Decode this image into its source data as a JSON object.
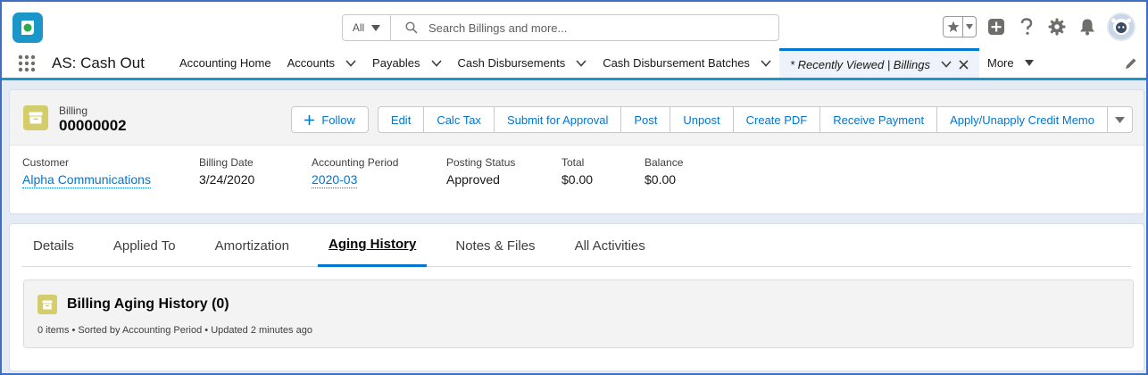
{
  "header": {
    "search_scope": "All",
    "search_placeholder": "Search Billings and more...",
    "brand_color": "#1b96c8"
  },
  "nav": {
    "app_name": "AS: Cash Out",
    "items": [
      {
        "label": "Accounting Home",
        "has_caret": false
      },
      {
        "label": "Accounts",
        "has_caret": true
      },
      {
        "label": "Payables",
        "has_caret": true
      },
      {
        "label": "Cash Disbursements",
        "has_caret": true
      },
      {
        "label": "Cash Disbursement Batches",
        "has_caret": true
      }
    ],
    "active_tab": "* Recently Viewed | Billings",
    "more_label": "More"
  },
  "record": {
    "object_label": "Billing",
    "name": "00000002",
    "icon_color": "#d3cd6b",
    "follow_label": "Follow",
    "actions": [
      "Edit",
      "Calc Tax",
      "Submit for Approval",
      "Post",
      "Unpost",
      "Create PDF",
      "Receive Payment",
      "Apply/Unapply Credit Memo"
    ],
    "fields": [
      {
        "label": "Customer",
        "value": "Alpha Communications",
        "link": true
      },
      {
        "label": "Billing Date",
        "value": "3/24/2020",
        "link": false
      },
      {
        "label": "Accounting Period",
        "value": "2020-03",
        "link": true
      },
      {
        "label": "Posting Status",
        "value": "Approved",
        "link": false
      },
      {
        "label": "Total",
        "value": "$0.00",
        "link": false
      },
      {
        "label": "Balance",
        "value": "$0.00",
        "link": false
      }
    ]
  },
  "tabs": {
    "items": [
      "Details",
      "Applied To",
      "Amortization",
      "Aging History",
      "Notes & Files",
      "All Activities"
    ],
    "active": "Aging History"
  },
  "related_list": {
    "title": "Billing Aging History (0)",
    "meta": "0 items • Sorted by Accounting Period • Updated 2 minutes ago"
  }
}
